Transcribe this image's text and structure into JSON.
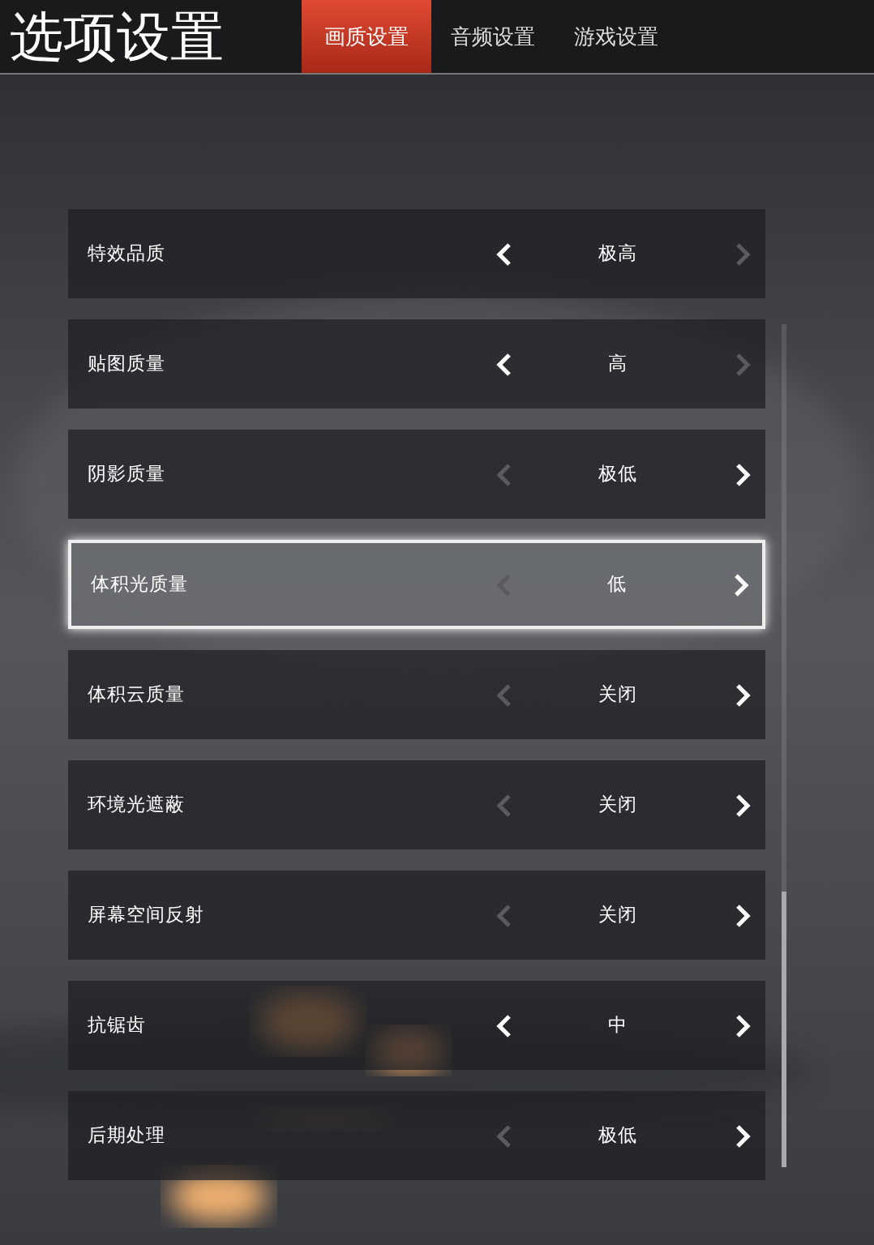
{
  "header": {
    "title": "选项设置",
    "tabs": [
      {
        "label": "画质设置",
        "selected": true
      },
      {
        "label": "音频设置",
        "selected": false
      },
      {
        "label": "游戏设置",
        "selected": false
      }
    ]
  },
  "settings": [
    {
      "label": "特效品质",
      "value": "极高",
      "left_enabled": true,
      "right_enabled": false,
      "selected": false
    },
    {
      "label": "贴图质量",
      "value": "高",
      "left_enabled": true,
      "right_enabled": false,
      "selected": false
    },
    {
      "label": "阴影质量",
      "value": "极低",
      "left_enabled": false,
      "right_enabled": true,
      "selected": false
    },
    {
      "label": "体积光质量",
      "value": "低",
      "left_enabled": false,
      "right_enabled": true,
      "selected": true
    },
    {
      "label": "体积云质量",
      "value": "关闭",
      "left_enabled": false,
      "right_enabled": true,
      "selected": false
    },
    {
      "label": "环境光遮蔽",
      "value": "关闭",
      "left_enabled": false,
      "right_enabled": true,
      "selected": false
    },
    {
      "label": "屏幕空间反射",
      "value": "关闭",
      "left_enabled": false,
      "right_enabled": true,
      "selected": false
    },
    {
      "label": "抗锯齿",
      "value": "中",
      "left_enabled": true,
      "right_enabled": true,
      "selected": false
    },
    {
      "label": "后期处理",
      "value": "极低",
      "left_enabled": false,
      "right_enabled": true,
      "selected": false
    }
  ]
}
